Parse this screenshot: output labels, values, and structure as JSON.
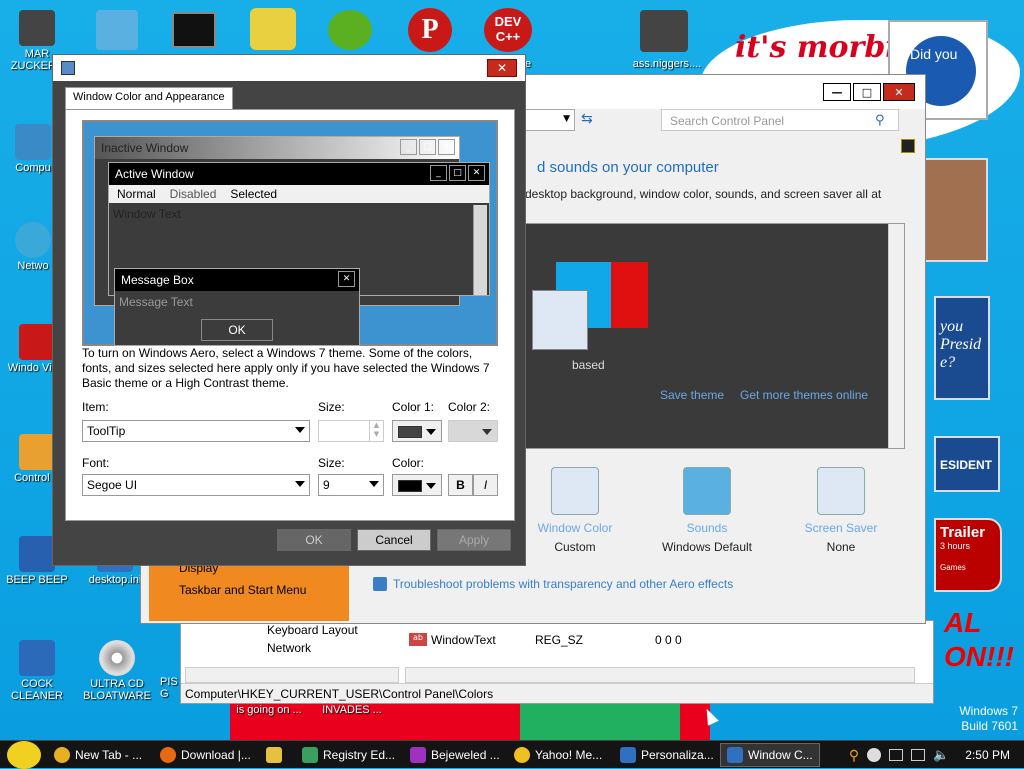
{
  "desktop": {
    "wallpaper_text": "it's morbi",
    "pic_texts": [
      "Did you",
      "you",
      "Presid",
      "e?",
      "ESIDENT",
      "Trailer",
      "3 hours",
      "Games",
      "AL",
      "ON!!!"
    ],
    "icons": [
      {
        "label": "MAR ZUCKERE",
        "color": "#444"
      },
      {
        "label": "Compu",
        "color": "#3a8ac8"
      },
      {
        "label": "Netwo",
        "color": "#3aa8d8"
      },
      {
        "label": "Windo Vista",
        "color": "#c81818"
      },
      {
        "label": "Control P",
        "color": "#e8a030"
      },
      {
        "label": "BEEP BEEP",
        "color": "#2860b0"
      },
      {
        "label": "desktop.ini",
        "color": "#3070c0"
      },
      {
        "label": "COCK CLEANER",
        "color": "#2a6ab8"
      },
      {
        "label": "ULTRA CD BLOATWARE",
        "color": "#999"
      },
      {
        "label": "PIS IN VIDEO G",
        "color": "#555"
      },
      {
        "label": "is going on ...",
        "color": "#a00"
      },
      {
        "label": "INVADES ...",
        "color": "#a00"
      },
      {
        "label": "ass.niggers....",
        "color": "#333"
      },
      {
        "label": "e",
        "color": "#c00"
      }
    ],
    "win7_label": [
      "Windows 7",
      "Build 7601"
    ]
  },
  "control_panel": {
    "search_placeholder": "Search Control Panel",
    "heading": "d sounds on your computer",
    "subtext": "desktop background, window color, sounds, and screen saver all at",
    "theme_name": "based",
    "save_theme": "Save theme",
    "get_more": "Get more themes online",
    "tiles": [
      {
        "title": "Window Color",
        "value": "Custom"
      },
      {
        "title": "Sounds",
        "value": "Windows Default"
      },
      {
        "title": "Screen Saver",
        "value": "None"
      }
    ],
    "sidebar_items": [
      "Display",
      "Taskbar and Start Menu"
    ],
    "troubleshoot": "Troubleshoot problems with transparency and other Aero effects"
  },
  "regedit": {
    "tree": [
      "Keyboard Layout",
      "Network"
    ],
    "row": {
      "name": "WindowText",
      "type": "REG_SZ",
      "data": "0 0 0"
    },
    "status": "Computer\\HKEY_CURRENT_USER\\Control Panel\\Colors"
  },
  "dialog": {
    "tab": "Window Color and Appearance",
    "preview": {
      "inactive_title": "Inactive Window",
      "active_title": "Active Window",
      "menu": [
        "Normal",
        "Disabled",
        "Selected"
      ],
      "window_text": "Window Text",
      "msgbox_title": "Message Box",
      "msgbox_text": "Message Text",
      "msgbox_ok": "OK"
    },
    "help": "To turn on Windows Aero, select a Windows 7 theme.  Some of the colors, fonts, and sizes selected here apply only if you have selected the Windows 7 Basic theme or a High Contrast theme.",
    "item_label": "Item:",
    "item_value": "ToolTip",
    "size_label": "Size:",
    "size1_value": "",
    "color1_label": "Color 1:",
    "color2_label": "Color 2:",
    "font_label": "Font:",
    "font_value": "Segoe UI",
    "size2_label": "Size:",
    "size2_value": "9",
    "color_label": "Color:",
    "bold": "B",
    "italic": "I",
    "ok": "OK",
    "cancel": "Cancel",
    "apply": "Apply",
    "colors": {
      "color1": "#444444",
      "color2": "#d8d8d8",
      "font_color": "#000000"
    }
  },
  "taskbar": {
    "items": [
      {
        "label": "New Tab - ...",
        "icon": "chrome-icon",
        "color": "#e8b020"
      },
      {
        "label": "Download |...",
        "icon": "firefox-icon",
        "color": "#e86a10"
      },
      {
        "label": "",
        "icon": "folder-icon",
        "color": "#e8c040"
      },
      {
        "label": "Registry Ed...",
        "icon": "regedit-icon",
        "color": "#3aa060"
      },
      {
        "label": "Bejeweled ...",
        "icon": "bejeweled-icon",
        "color": "#a030c0"
      },
      {
        "label": "Yahoo! Me...",
        "icon": "yahoo-messenger-icon",
        "color": "#f0c020"
      },
      {
        "label": "Personaliza...",
        "icon": "personalize-icon",
        "color": "#3070c0"
      },
      {
        "label": "Window C...",
        "icon": "window-color-icon",
        "color": "#3070c0"
      }
    ],
    "time": "2:50 PM"
  }
}
